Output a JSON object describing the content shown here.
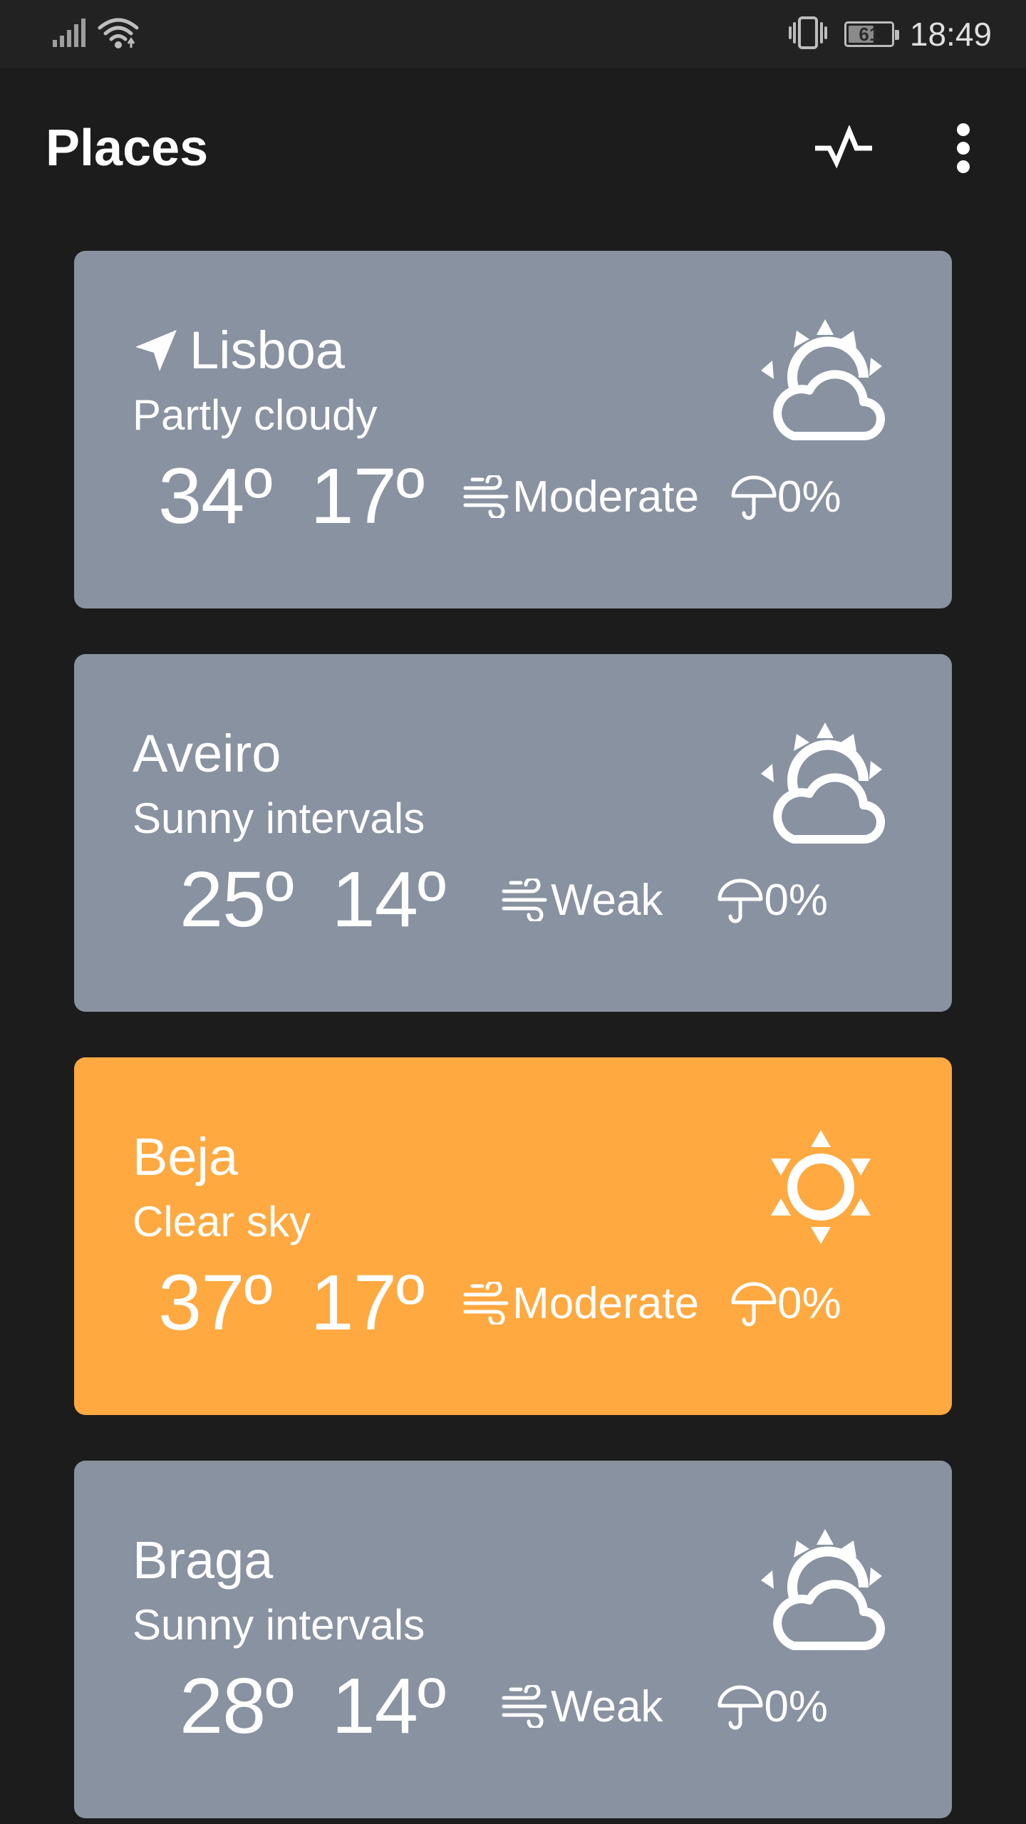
{
  "status_bar": {
    "time": "18:49",
    "battery": "61",
    "battery_level": 0.61,
    "icons": [
      "signal-icon",
      "wifi-icon",
      "vibrate-icon",
      "battery-icon"
    ]
  },
  "app_bar": {
    "title": "Places",
    "actions": [
      "pulse-icon",
      "more-vert-icon"
    ]
  },
  "colors": {
    "card_default": "#8892a0",
    "card_highlight": "#ffa940",
    "background": "#1c1c1c"
  },
  "places": [
    {
      "name": "Lisboa",
      "current_location": true,
      "description": "Partly cloudy",
      "temp_max": "34º",
      "temp_min": "17º",
      "wind": "Moderate",
      "precip": "0%",
      "icon": "partly-cloudy-icon",
      "color": "#8892a0"
    },
    {
      "name": "Aveiro",
      "current_location": false,
      "description": "Sunny intervals",
      "temp_max": "25º",
      "temp_min": "14º",
      "wind": "Weak",
      "precip": "0%",
      "icon": "partly-cloudy-icon",
      "color": "#8892a0"
    },
    {
      "name": "Beja",
      "current_location": false,
      "description": "Clear sky",
      "temp_max": "37º",
      "temp_min": "17º",
      "wind": "Moderate",
      "precip": "0%",
      "icon": "sun-icon",
      "color": "#ffa940"
    },
    {
      "name": "Braga",
      "current_location": false,
      "description": "Sunny intervals",
      "temp_max": "28º",
      "temp_min": "14º",
      "wind": "Weak",
      "precip": "0%",
      "icon": "partly-cloudy-icon",
      "color": "#8892a0"
    }
  ]
}
